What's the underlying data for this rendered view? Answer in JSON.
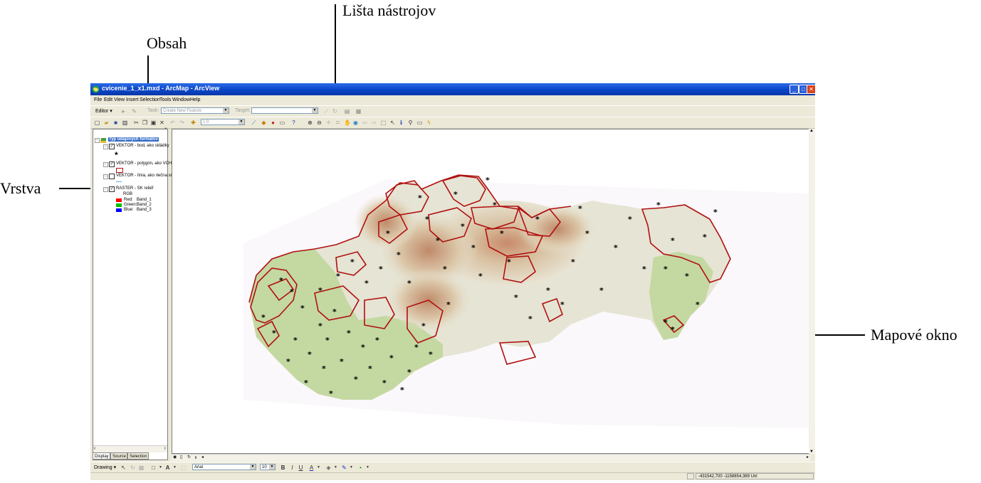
{
  "annotations": {
    "toolbar": "Lišta nástrojov",
    "toc": "Obsah",
    "layer": "Vrstva",
    "map_window": "Mapové okno"
  },
  "window": {
    "title": "cvicenie_1_x1.mxd - ArcMap - ArcView",
    "controls": {
      "minimize": "_",
      "maximize": "□",
      "close": "✕"
    }
  },
  "menu": [
    "File",
    "Edit",
    "View",
    "Insert",
    "Selection",
    "Tools",
    "Window",
    "Help"
  ],
  "editor_toolbar": {
    "editor_label": "Editor ▾",
    "task_label": "Task:",
    "task_value": "Create New Feature",
    "target_label": "Target:"
  },
  "standard_toolbar": {
    "scale_value": "1:0"
  },
  "toc": {
    "root_label": "Typ údajových formátov",
    "layers": [
      {
        "name": "VEKTOR - bod, ako skládky",
        "checked": true
      },
      {
        "name": "VEKTOR - polygón, ako VCH",
        "checked": true
      },
      {
        "name": "VEKTOR - línia, ako riečna sieť",
        "checked": false
      },
      {
        "name": "RASTER - SK reliéf",
        "checked": true
      }
    ],
    "raster_legend": {
      "header": "RGB",
      "bands": [
        {
          "label": "Red:",
          "band": "Band_1",
          "color": "#ff0000"
        },
        {
          "label": "Green:",
          "band": "Band_2",
          "color": "#00c000"
        },
        {
          "label": "Blue:",
          "band": "Band_3",
          "color": "#0000ff"
        }
      ]
    },
    "tabs": [
      "Display",
      "Source",
      "Selection"
    ]
  },
  "draw_toolbar": {
    "drawing_label": "Drawing ▾",
    "font_name": "Arial",
    "font_size": "10",
    "bold": "B",
    "italic": "I",
    "underline": "U"
  },
  "status": {
    "coordinates": "-431542,700  -1158854,389 Unl"
  },
  "colors": {
    "polygon_outline": "#b01010",
    "lowland": "#c4d8a2",
    "titlebar": "#0a45c8"
  }
}
